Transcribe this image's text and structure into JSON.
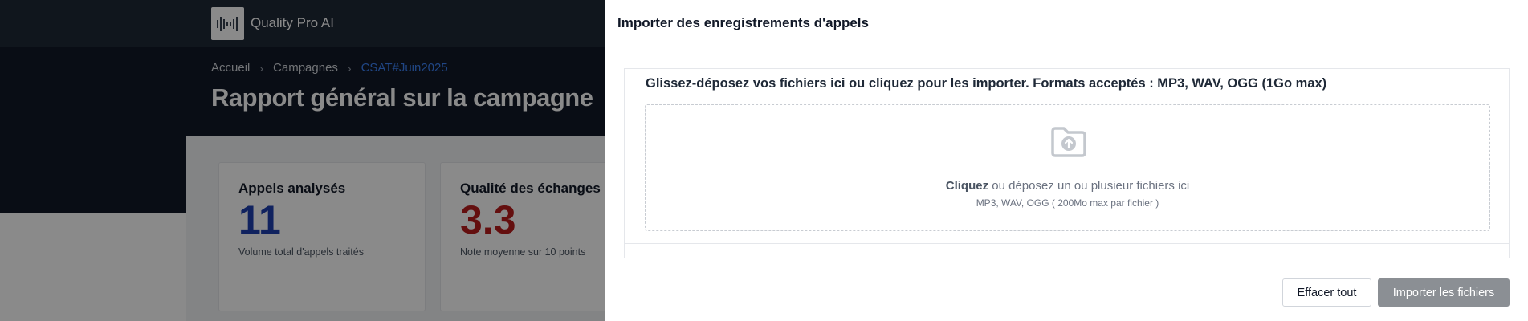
{
  "app": {
    "name": "Quality Pro AI",
    "logo_icon": "soundwave-icon"
  },
  "breadcrumb": {
    "items": [
      "Accueil",
      "Campagnes",
      "CSAT#Juin2025"
    ],
    "separator": "›"
  },
  "page": {
    "title": "Rapport général sur la campagne"
  },
  "cards": [
    {
      "title": "Appels analysés",
      "value": "11",
      "subtitle": "Volume total d'appels traités",
      "value_color": "#1e40af"
    },
    {
      "title": "Qualité des échanges",
      "value": "3.3",
      "subtitle": "Note moyenne sur 10 points",
      "value_color": "#b91c1c"
    }
  ],
  "modal": {
    "title": "Importer des enregistrements d'appels",
    "uploader_label": "Glissez-déposez vos fichiers ici ou cliquez pour les importer. Formats acceptés : MP3, WAV, OGG (1Go max)",
    "dropzone": {
      "icon": "folder-upload-icon",
      "click_word": "Cliquez",
      "text_rest": " ou déposez un ou plusieur fichiers ici",
      "hint": "MP3, WAV, OGG ( 200Mo max par fichier )"
    },
    "buttons": {
      "clear": "Effacer tout",
      "import": "Importer les fichiers"
    }
  },
  "colors": {
    "accent": "#3b82f6",
    "import_button": "#8b8f94"
  }
}
